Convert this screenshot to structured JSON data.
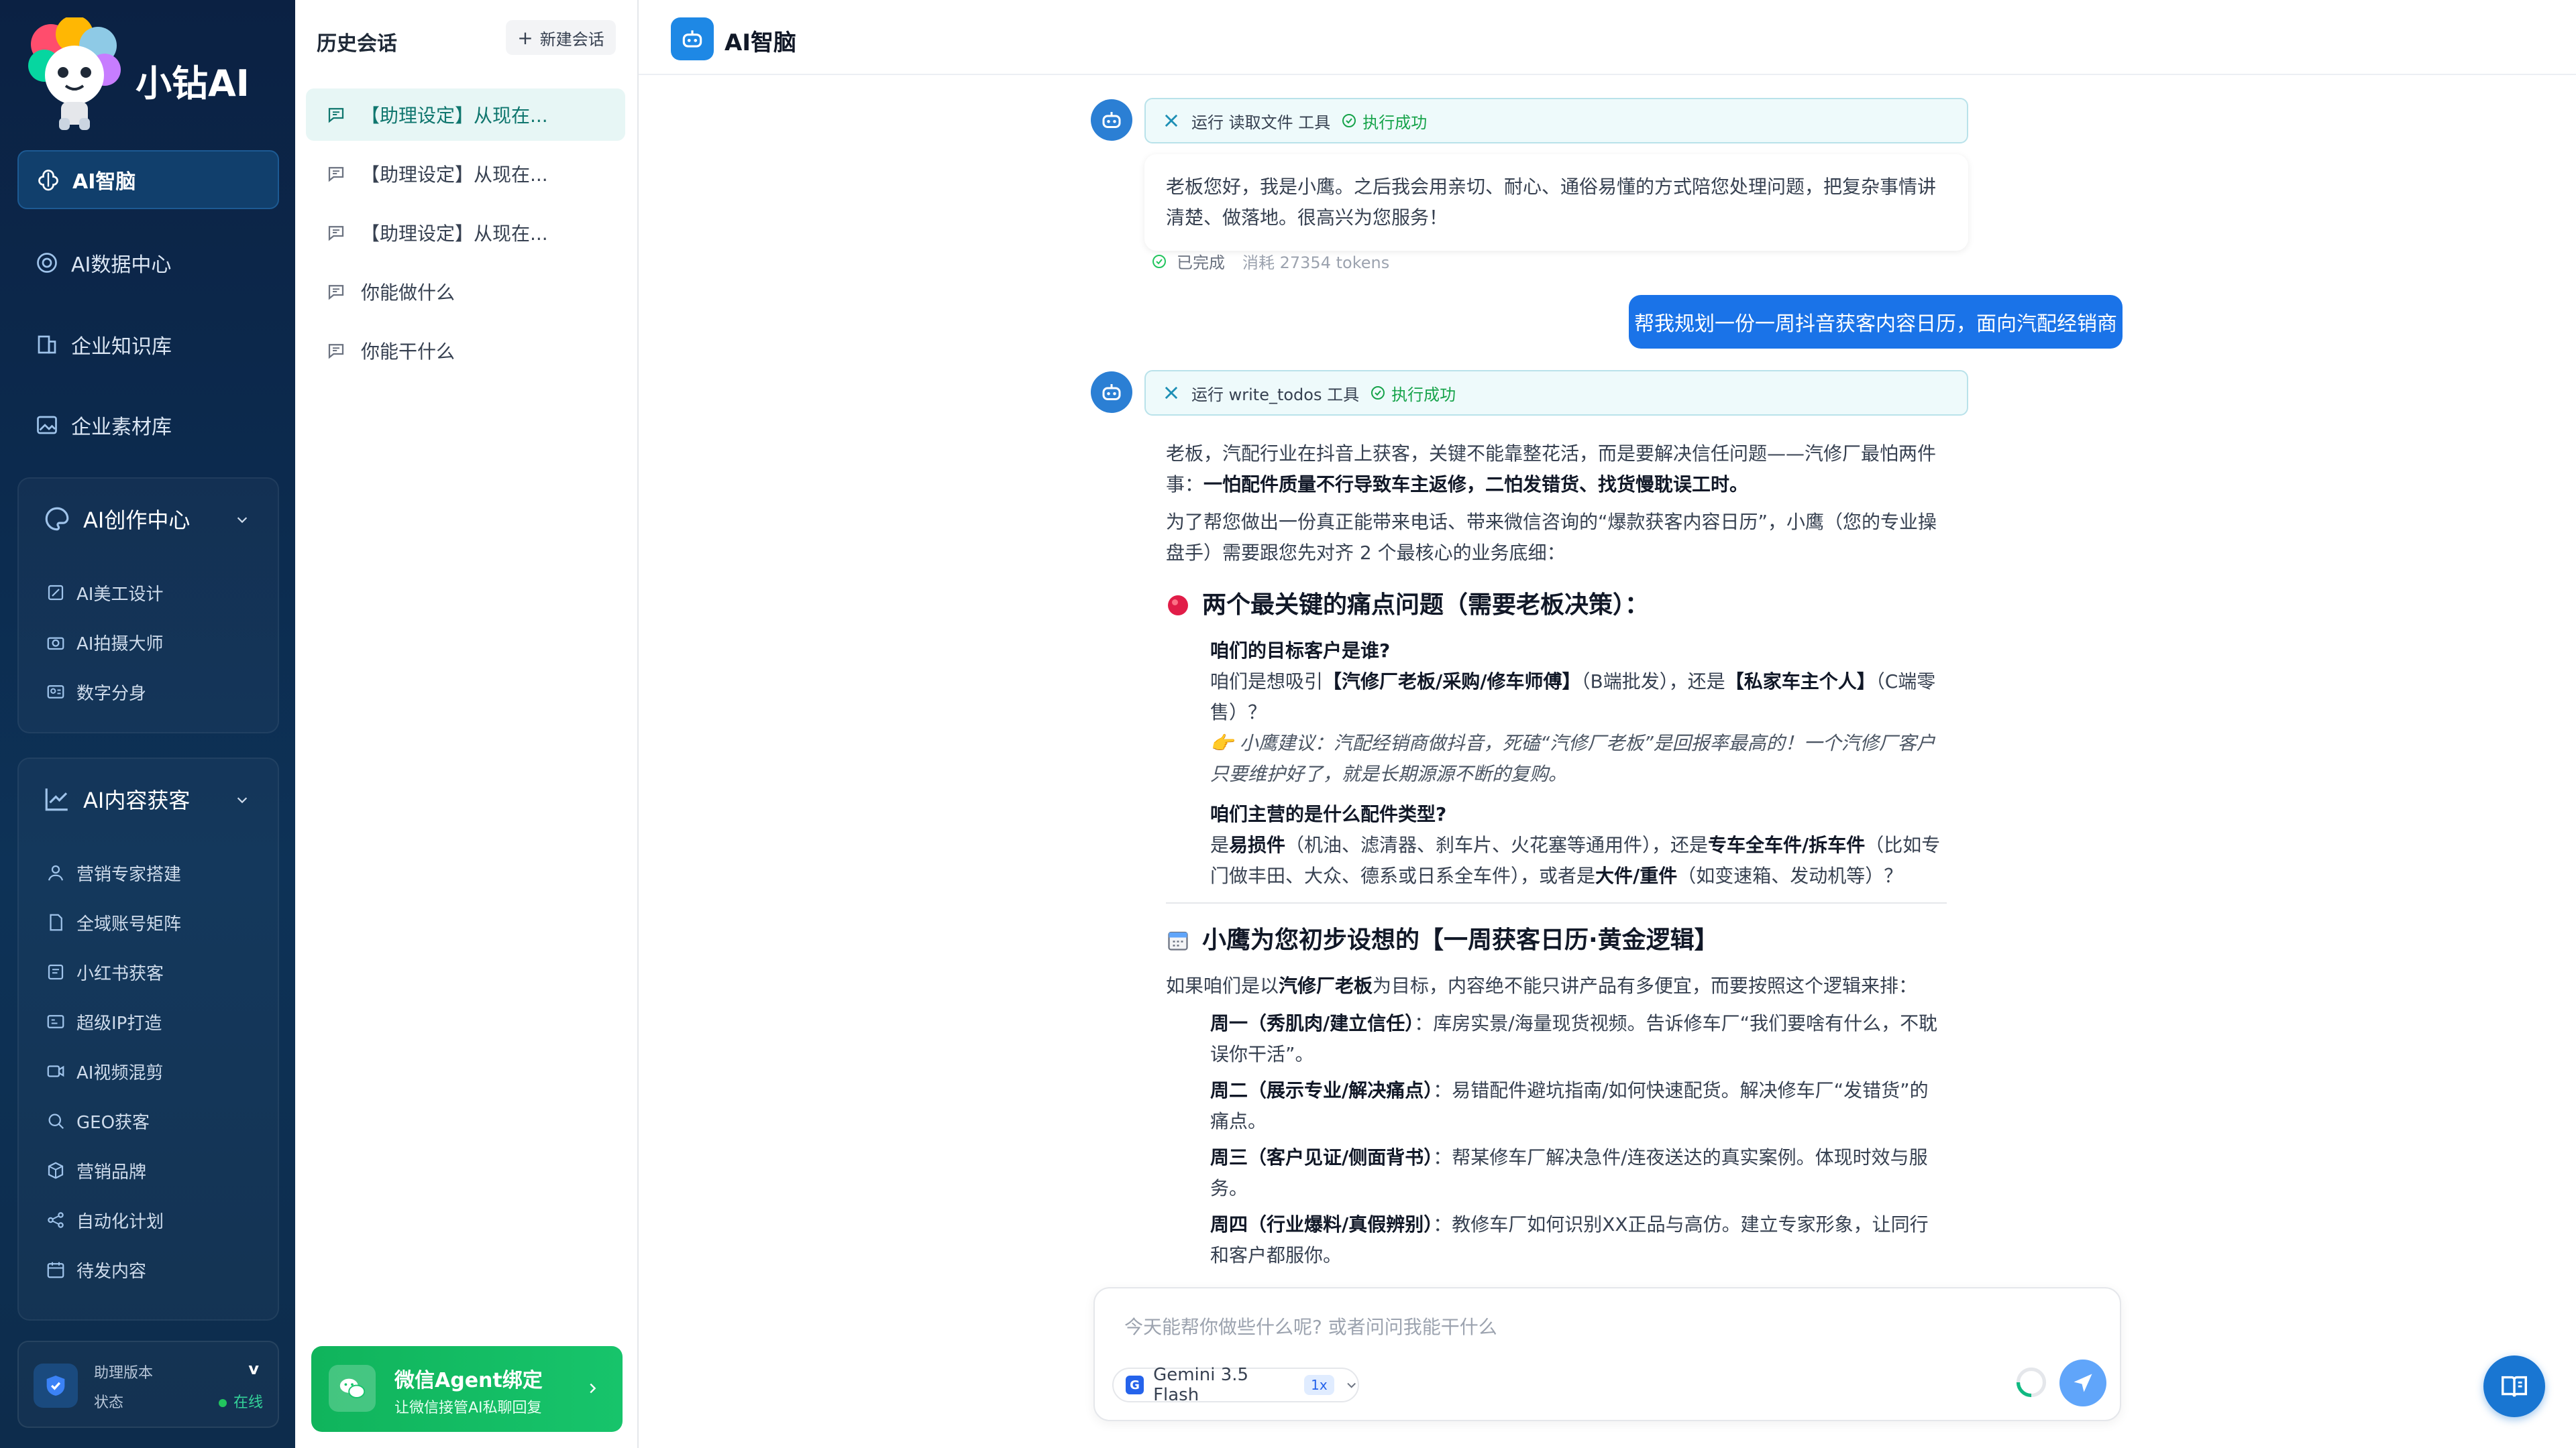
{
  "brand": {
    "name": "小钻AI"
  },
  "sidebar": {
    "items": [
      {
        "label": "AI智脑",
        "icon": "brain-icon",
        "active": true
      },
      {
        "label": "AI数据中心",
        "icon": "data-center-icon"
      },
      {
        "label": "企业知识库",
        "icon": "knowledge-base-icon"
      },
      {
        "label": "企业素材库",
        "icon": "materials-icon"
      }
    ],
    "groups": [
      {
        "label": "AI创作中心",
        "icon": "palette-icon",
        "items": [
          {
            "label": "AI美工设计",
            "icon": "design-icon"
          },
          {
            "label": "AI拍摄大师",
            "icon": "camera-icon"
          },
          {
            "label": "数字分身",
            "icon": "avatar-card-icon"
          }
        ]
      },
      {
        "label": "AI内容获客",
        "icon": "trend-chart-icon",
        "items": [
          {
            "label": "营销专家搭建",
            "icon": "user-icon"
          },
          {
            "label": "全域账号矩阵",
            "icon": "file-icon"
          },
          {
            "label": "小红书获客",
            "icon": "book-icon"
          },
          {
            "label": "超级IP打造",
            "icon": "id-card-icon"
          },
          {
            "label": "AI视频混剪",
            "icon": "video-icon"
          },
          {
            "label": "GEO获客",
            "icon": "search-icon"
          },
          {
            "label": "营销品牌",
            "icon": "box-icon"
          },
          {
            "label": "自动化计划",
            "icon": "share-icon"
          },
          {
            "label": "待发内容",
            "icon": "calendar-icon"
          }
        ]
      }
    ],
    "version": {
      "label": "助理版本",
      "value": "v",
      "status_label": "状态",
      "status_value": "在线"
    }
  },
  "history": {
    "title": "历史会话",
    "new_label": "新建会话",
    "items": [
      {
        "label": "【助理设定】从现在...",
        "active": true
      },
      {
        "label": "【助理设定】从现在..."
      },
      {
        "label": "【助理设定】从现在..."
      },
      {
        "label": "你能做什么"
      },
      {
        "label": "你能干什么"
      }
    ],
    "wechat": {
      "title": "微信Agent绑定",
      "subtitle": "让微信接管AI私聊回复"
    }
  },
  "topbar": {
    "title": "AI智脑"
  },
  "chat": {
    "tool1": {
      "run": "运行 读取文件 工具",
      "status": "执行成功"
    },
    "msg1": "老板您好，我是小鹰。之后我会用亲切、耐心、通俗易懂的方式陪您处理问题，把复杂事情讲清楚、做落地。很高兴为您服务！",
    "done": "已完成",
    "tokens": "消耗 27354 tokens",
    "user_msg": "帮我规划一份一周抖音获客内容日历，面向汽配经销商",
    "tool2": {
      "run": "运行 write_todos 工具",
      "status": "执行成功"
    },
    "answer": {
      "p1a": "老板，汽配行业在抖音上获客，关键不能靠整花活，而是要解决信任问题——汽修厂最怕两件事：",
      "p1b": "一怕配件质量不行导致车主返修，二怕发错货、找货慢耽误工时。",
      "p2": "为了帮您做出一份真正能带来电话、带来微信咨询的“爆款获客内容日历”，小鹰（您的专业操盘手）需要跟您先对齐 2 个最核心的业务底细：",
      "h1": "两个最关键的痛点问题（需要老板决策）：",
      "q1": "咱们的目标客户是谁?",
      "q1a": "咱们是想吸引",
      "q1b": "【汽修厂老板/采购/修车师傅】",
      "q1c": "（B端批发），还是",
      "q1d": "【私家车主个人】",
      "q1e": "（C端零售）？",
      "tip": "👉 小鹰建议：汽配经销商做抖音，死磕“汽修厂老板”是回报率最高的！一个汽修厂客户只要维护好了，就是长期源源不断的复购。",
      "q2": "咱们主营的是什么配件类型?",
      "q2a": "是",
      "q2b": "易损件",
      "q2c": "（机油、滤清器、刹车片、火花塞等通用件），还是",
      "q2d": "专车全车件/拆车件",
      "q2e": "（比如专门做丰田、大众、德系或日系全车件），或者是",
      "q2f": "大件/重件",
      "q2g": "（如变速箱、发动机等）？",
      "h2": "小鹰为您初步设想的【一周获客日历·黄金逻辑】",
      "p3a": "如果咱们是以",
      "p3b": "汽修厂老板",
      "p3c": "为目标，内容绝不能只讲产品有多便宜，而要按照这个逻辑来排：",
      "days": [
        {
          "day": "周一（秀肌肉/建立信任）",
          "text": "：库房实景/海量现货视频。告诉修车厂“我们要啥有什么，不耽误你干活”。"
        },
        {
          "day": "周二（展示专业/解决痛点）",
          "text": "：易错配件避坑指南/如何快速配货。解决修车厂“发错货”的痛点。"
        },
        {
          "day": "周三（客户见证/侧面背书）",
          "text": "：帮某修车厂解决急件/连夜送达的真实案例。体现时效与服务。"
        },
        {
          "day": "周四（行业爆料/真假辨别）",
          "text": "：教修车厂如何识别XX正品与高仿。建立专家形象，让同行和客户都服你。"
        }
      ]
    }
  },
  "composer": {
    "placeholder": "今天能帮你做些什么呢? 或者问问我能干什么",
    "model": "Gemini 3.5 Flash",
    "speed": "1x"
  }
}
